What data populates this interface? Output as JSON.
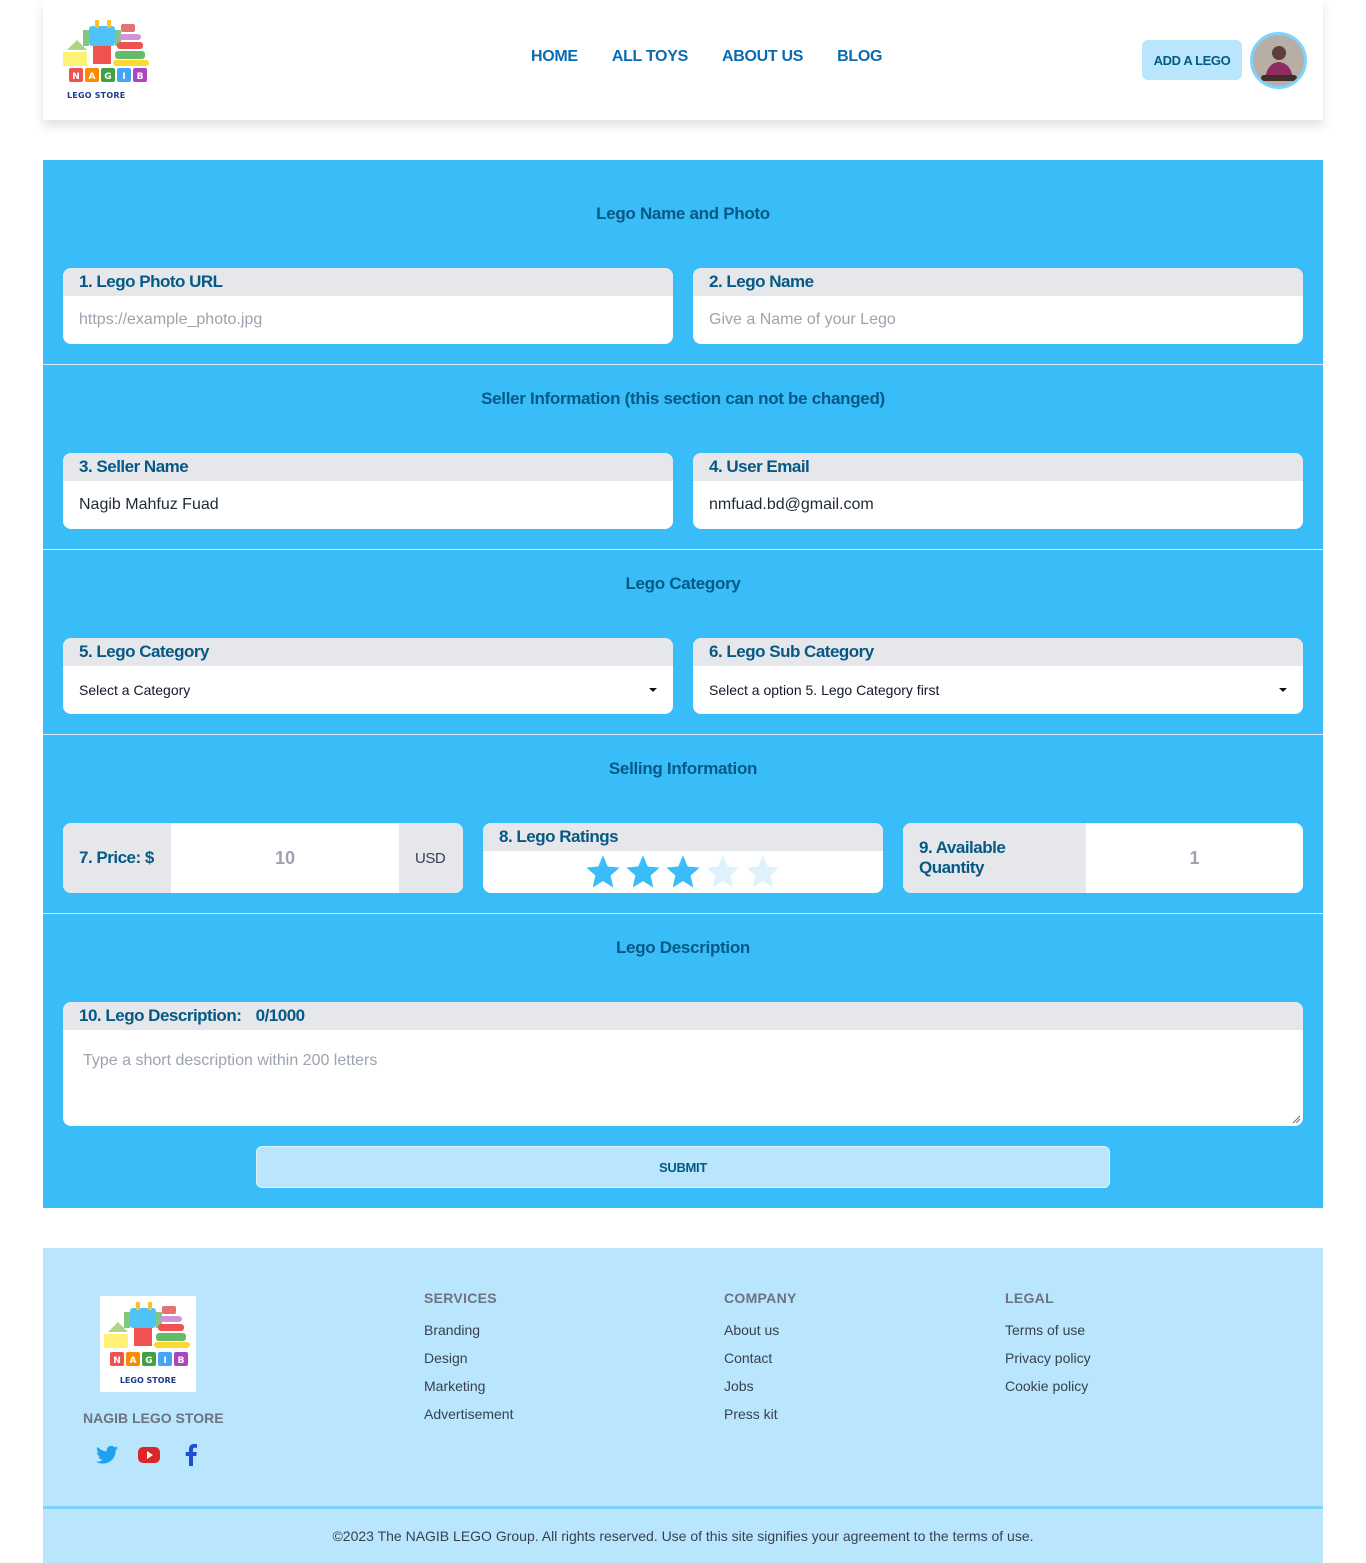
{
  "nav": {
    "logo_text": "LEGO STORE",
    "links": [
      "HOME",
      "ALL TOYS",
      "ABOUT US",
      "BLOG"
    ],
    "add_button": "ADD A LEGO"
  },
  "form": {
    "sections": {
      "s1": "Lego Name and Photo",
      "s2": "Seller Information (this section can not be changed)",
      "s3": "Lego Category",
      "s4": "Selling Information",
      "s5": "Lego Description"
    },
    "photo": {
      "label": "1. Lego Photo URL",
      "placeholder": "https://example_photo.jpg"
    },
    "name": {
      "label": "2. Lego Name",
      "placeholder": "Give a Name of your Lego"
    },
    "seller": {
      "label": "3. Seller Name",
      "value": "Nagib Mahfuz Fuad"
    },
    "email": {
      "label": "4. User Email",
      "value": "nmfuad.bd@gmail.com"
    },
    "category": {
      "label": "5. Lego Category",
      "selected": "Select a Category"
    },
    "subcategory": {
      "label": "6. Lego Sub Category",
      "selected": "Select a option 5. Lego Category first"
    },
    "price": {
      "label": "7. Price: $",
      "value": "10",
      "unit": "USD"
    },
    "ratings": {
      "label": "8. Lego Ratings",
      "value": 3,
      "max": 5,
      "color_on": "#38bdf8",
      "color_off": "#e0f2fe"
    },
    "quantity": {
      "label": "9. Available Quantity",
      "value": "1"
    },
    "description": {
      "label": "10. Lego Description:",
      "counter": "0/1000",
      "placeholder": "Type a short description within 200 letters"
    },
    "submit": "SUBMIT"
  },
  "footer": {
    "logo_text": "LEGO STORE",
    "brand": "NAGIB LEGO STORE",
    "socials": [
      "twitter-icon",
      "youtube-icon",
      "facebook-icon"
    ],
    "services": {
      "title": "SERVICES",
      "links": [
        "Branding",
        "Design",
        "Marketing",
        "Advertisement"
      ]
    },
    "company": {
      "title": "COMPANY",
      "links": [
        "About us",
        "Contact",
        "Jobs",
        "Press kit"
      ]
    },
    "legal": {
      "title": "LEGAL",
      "links": [
        "Terms of use",
        "Privacy policy",
        "Cookie policy"
      ]
    },
    "copyright": "©2023 The NAGIB LEGO Group. All rights reserved. Use of this site signifies your agreement to the terms of use."
  },
  "colors": {
    "accent": "#38bdf8",
    "dark_blue": "#075985",
    "light_blue": "#bae6fd"
  }
}
